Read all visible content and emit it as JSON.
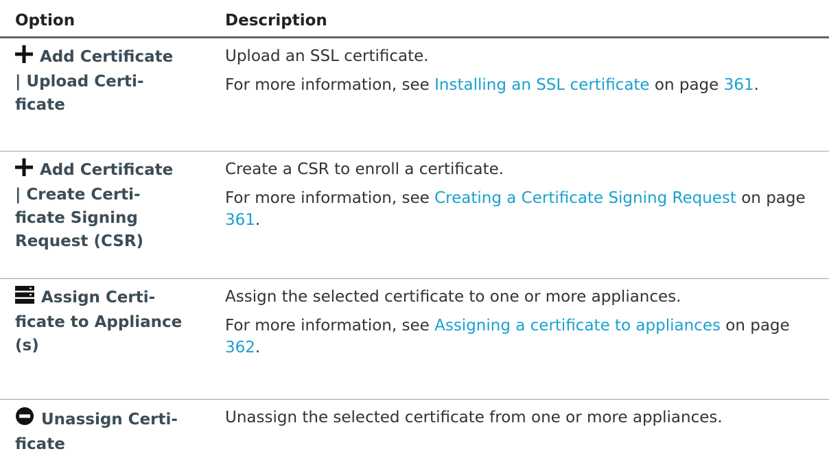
{
  "header": {
    "option": "Option",
    "description": "Description"
  },
  "rows": [
    {
      "icon": "plus-icon",
      "title_first": "Add Certificate",
      "title_rest": "| Upload Certi-",
      "title_rest2": "ficate",
      "desc": "Upload an SSL certificate.",
      "more_prefix": "For more information, see ",
      "link": "Installing an SSL certificate",
      "mid": " on page ",
      "page": "361",
      "suffix": "."
    },
    {
      "icon": "plus-icon",
      "title_first": "Add Certificate",
      "title_rest": "| Create Certi-",
      "title_rest2": "ficate Signing",
      "title_rest3": "Request (CSR)",
      "desc": "Create a CSR to enroll a certificate.",
      "more_prefix": "For more information, see ",
      "link": "Creating a Certificate Signing Request",
      "mid": " on page ",
      "page": "361",
      "suffix": "."
    },
    {
      "icon": "server-icon",
      "title_first": "Assign Certi-",
      "title_rest": "ficate to Appliance",
      "title_rest2": "(s)",
      "desc": "Assign the selected certificate to one or more appliances.",
      "more_prefix": "For more information, see ",
      "link": "Assigning a certificate to appliances",
      "mid": " on page ",
      "page": "362",
      "suffix": "."
    },
    {
      "icon": "minus-circle-icon",
      "title_first": "Unassign Certi-",
      "title_rest": "ficate",
      "desc": "Unassign the selected certificate from one or more appliances."
    }
  ]
}
